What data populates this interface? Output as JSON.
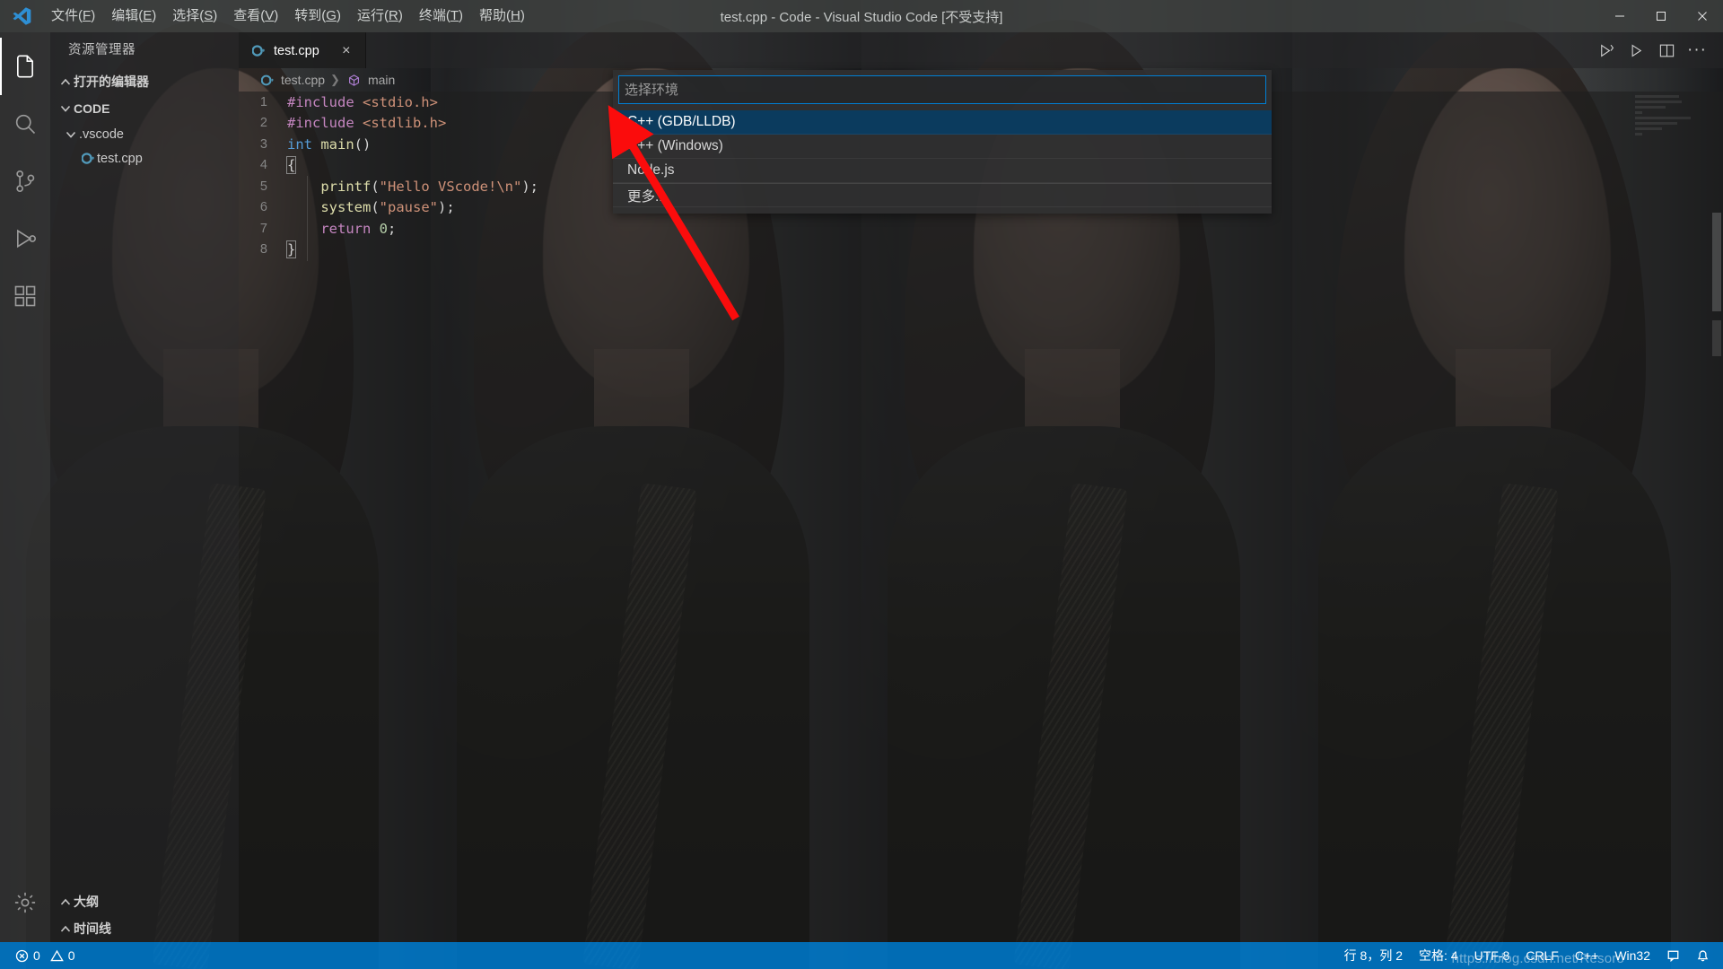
{
  "window": {
    "title": "test.cpp - Code - Visual Studio Code [不受支持]",
    "logo_icon": "vscode-logo-icon",
    "controls": {
      "minimize": "minimize-icon",
      "maximize": "maximize-icon",
      "close": "close-icon"
    }
  },
  "menubar": {
    "items": [
      {
        "label": "文件(F)",
        "mnemonic": "F"
      },
      {
        "label": "编辑(E)",
        "mnemonic": "E"
      },
      {
        "label": "选择(S)",
        "mnemonic": "S"
      },
      {
        "label": "查看(V)",
        "mnemonic": "V"
      },
      {
        "label": "转到(G)",
        "mnemonic": "G"
      },
      {
        "label": "运行(R)",
        "mnemonic": "R"
      },
      {
        "label": "终端(T)",
        "mnemonic": "T"
      },
      {
        "label": "帮助(H)",
        "mnemonic": "H"
      }
    ]
  },
  "activitybar": {
    "items": [
      {
        "name": "explorer",
        "icon": "files-icon",
        "active": true
      },
      {
        "name": "search",
        "icon": "search-icon",
        "active": false
      },
      {
        "name": "source-control",
        "icon": "source-control-icon",
        "active": false
      },
      {
        "name": "run-and-debug",
        "icon": "run-debug-icon",
        "active": false
      },
      {
        "name": "extensions",
        "icon": "extensions-icon",
        "active": false
      }
    ],
    "bottom": [
      {
        "name": "manage",
        "icon": "gear-icon"
      }
    ]
  },
  "sidebar": {
    "title": "资源管理器",
    "sections": [
      {
        "label": "打开的编辑器",
        "expanded": false
      },
      {
        "label": "CODE",
        "expanded": true
      }
    ],
    "tree": [
      {
        "label": ".vscode",
        "type": "folder",
        "expanded": true,
        "indent": 1
      },
      {
        "label": "test.cpp",
        "type": "cpp-file",
        "indent": 2
      }
    ],
    "bottom_sections": [
      {
        "label": "大纲",
        "expanded": false
      },
      {
        "label": "时间线",
        "expanded": false
      }
    ]
  },
  "editor": {
    "tab": {
      "label": "test.cpp",
      "icon": "cpp-file-icon",
      "close": "×"
    },
    "actions": [
      {
        "name": "run-code",
        "icon": "run-code-icon"
      },
      {
        "name": "run-start-debugging",
        "icon": "play-icon"
      },
      {
        "name": "split-editor",
        "icon": "split-editor-icon"
      },
      {
        "name": "more-actions",
        "icon": "ellipsis-icon",
        "glyph": "···"
      }
    ],
    "breadcrumbs": [
      {
        "label": "test.cpp",
        "icon": "cpp-file-icon"
      },
      {
        "label": "main",
        "icon": "symbol-method-icon"
      }
    ],
    "lines": [
      {
        "n": 1,
        "tokens": [
          {
            "t": "#include",
            "c": "pp"
          },
          {
            "t": " <stdio.h>",
            "c": "inc"
          }
        ]
      },
      {
        "n": 2,
        "tokens": [
          {
            "t": "#include",
            "c": "pp"
          },
          {
            "t": " <stdlib.h>",
            "c": "inc"
          }
        ]
      },
      {
        "n": 3,
        "tokens": [
          {
            "t": "int",
            "c": "kw"
          },
          {
            "t": " ",
            "c": "plain"
          },
          {
            "t": "main",
            "c": "fn"
          },
          {
            "t": "()",
            "c": "punct"
          }
        ]
      },
      {
        "n": 4,
        "tokens": [
          {
            "t": "{",
            "c": "punct"
          }
        ]
      },
      {
        "n": 5,
        "tokens": [
          {
            "t": "    ",
            "c": "plain"
          },
          {
            "t": "printf",
            "c": "fn"
          },
          {
            "t": "(",
            "c": "punct"
          },
          {
            "t": "\"Hello VScode!\\n\"",
            "c": "str"
          },
          {
            "t": ");",
            "c": "punct"
          }
        ]
      },
      {
        "n": 6,
        "tokens": [
          {
            "t": "    ",
            "c": "plain"
          },
          {
            "t": "system",
            "c": "fn"
          },
          {
            "t": "(",
            "c": "punct"
          },
          {
            "t": "\"pause\"",
            "c": "str"
          },
          {
            "t": ");",
            "c": "punct"
          }
        ]
      },
      {
        "n": 7,
        "tokens": [
          {
            "t": "    ",
            "c": "plain"
          },
          {
            "t": "return",
            "c": "ctl"
          },
          {
            "t": " ",
            "c": "plain"
          },
          {
            "t": "0",
            "c": "num"
          },
          {
            "t": ";",
            "c": "punct"
          }
        ]
      },
      {
        "n": 8,
        "tokens": [
          {
            "t": "}",
            "c": "punct"
          }
        ]
      }
    ]
  },
  "quickpick": {
    "placeholder": "选择环境",
    "value": "",
    "items": [
      {
        "label": "C++ (GDB/LLDB)",
        "selected": true
      },
      {
        "label": "C++ (Windows)",
        "selected": false
      },
      {
        "label": "Node.js",
        "selected": false
      },
      {
        "label": "更多...",
        "selected": false,
        "separator_above": true
      }
    ]
  },
  "statusbar": {
    "left": [
      {
        "name": "problems",
        "icon": "error-icon",
        "errors": "0",
        "warn_icon": "warning-icon",
        "warnings": "0"
      }
    ],
    "right": [
      {
        "name": "cursor-position",
        "label": "行 8，列 2"
      },
      {
        "name": "indentation",
        "label": "空格: 4"
      },
      {
        "name": "encoding",
        "label": "UTF-8"
      },
      {
        "name": "eol",
        "label": "CRLF"
      },
      {
        "name": "language-mode",
        "label": "C++"
      },
      {
        "name": "win32-target",
        "label": "Win32"
      },
      {
        "name": "open-settings",
        "icon": "feedback-icon"
      },
      {
        "name": "notifications",
        "icon": "bell-icon"
      }
    ]
  },
  "watermark": {
    "text": "https://blog.csdn.net/Resoro"
  },
  "annotation": {
    "type": "arrow",
    "color": "#fb0c0c",
    "points_to": "C++ (GDB/LLDB)"
  },
  "colors": {
    "accent": "#007acc",
    "selection": "#0b3b5e",
    "titlebar": "#3c3f3e",
    "sidebar": "#252526",
    "editor": "#1e1e1e",
    "activitybar": "#333333",
    "annotation_red": "#fb0c0c"
  }
}
